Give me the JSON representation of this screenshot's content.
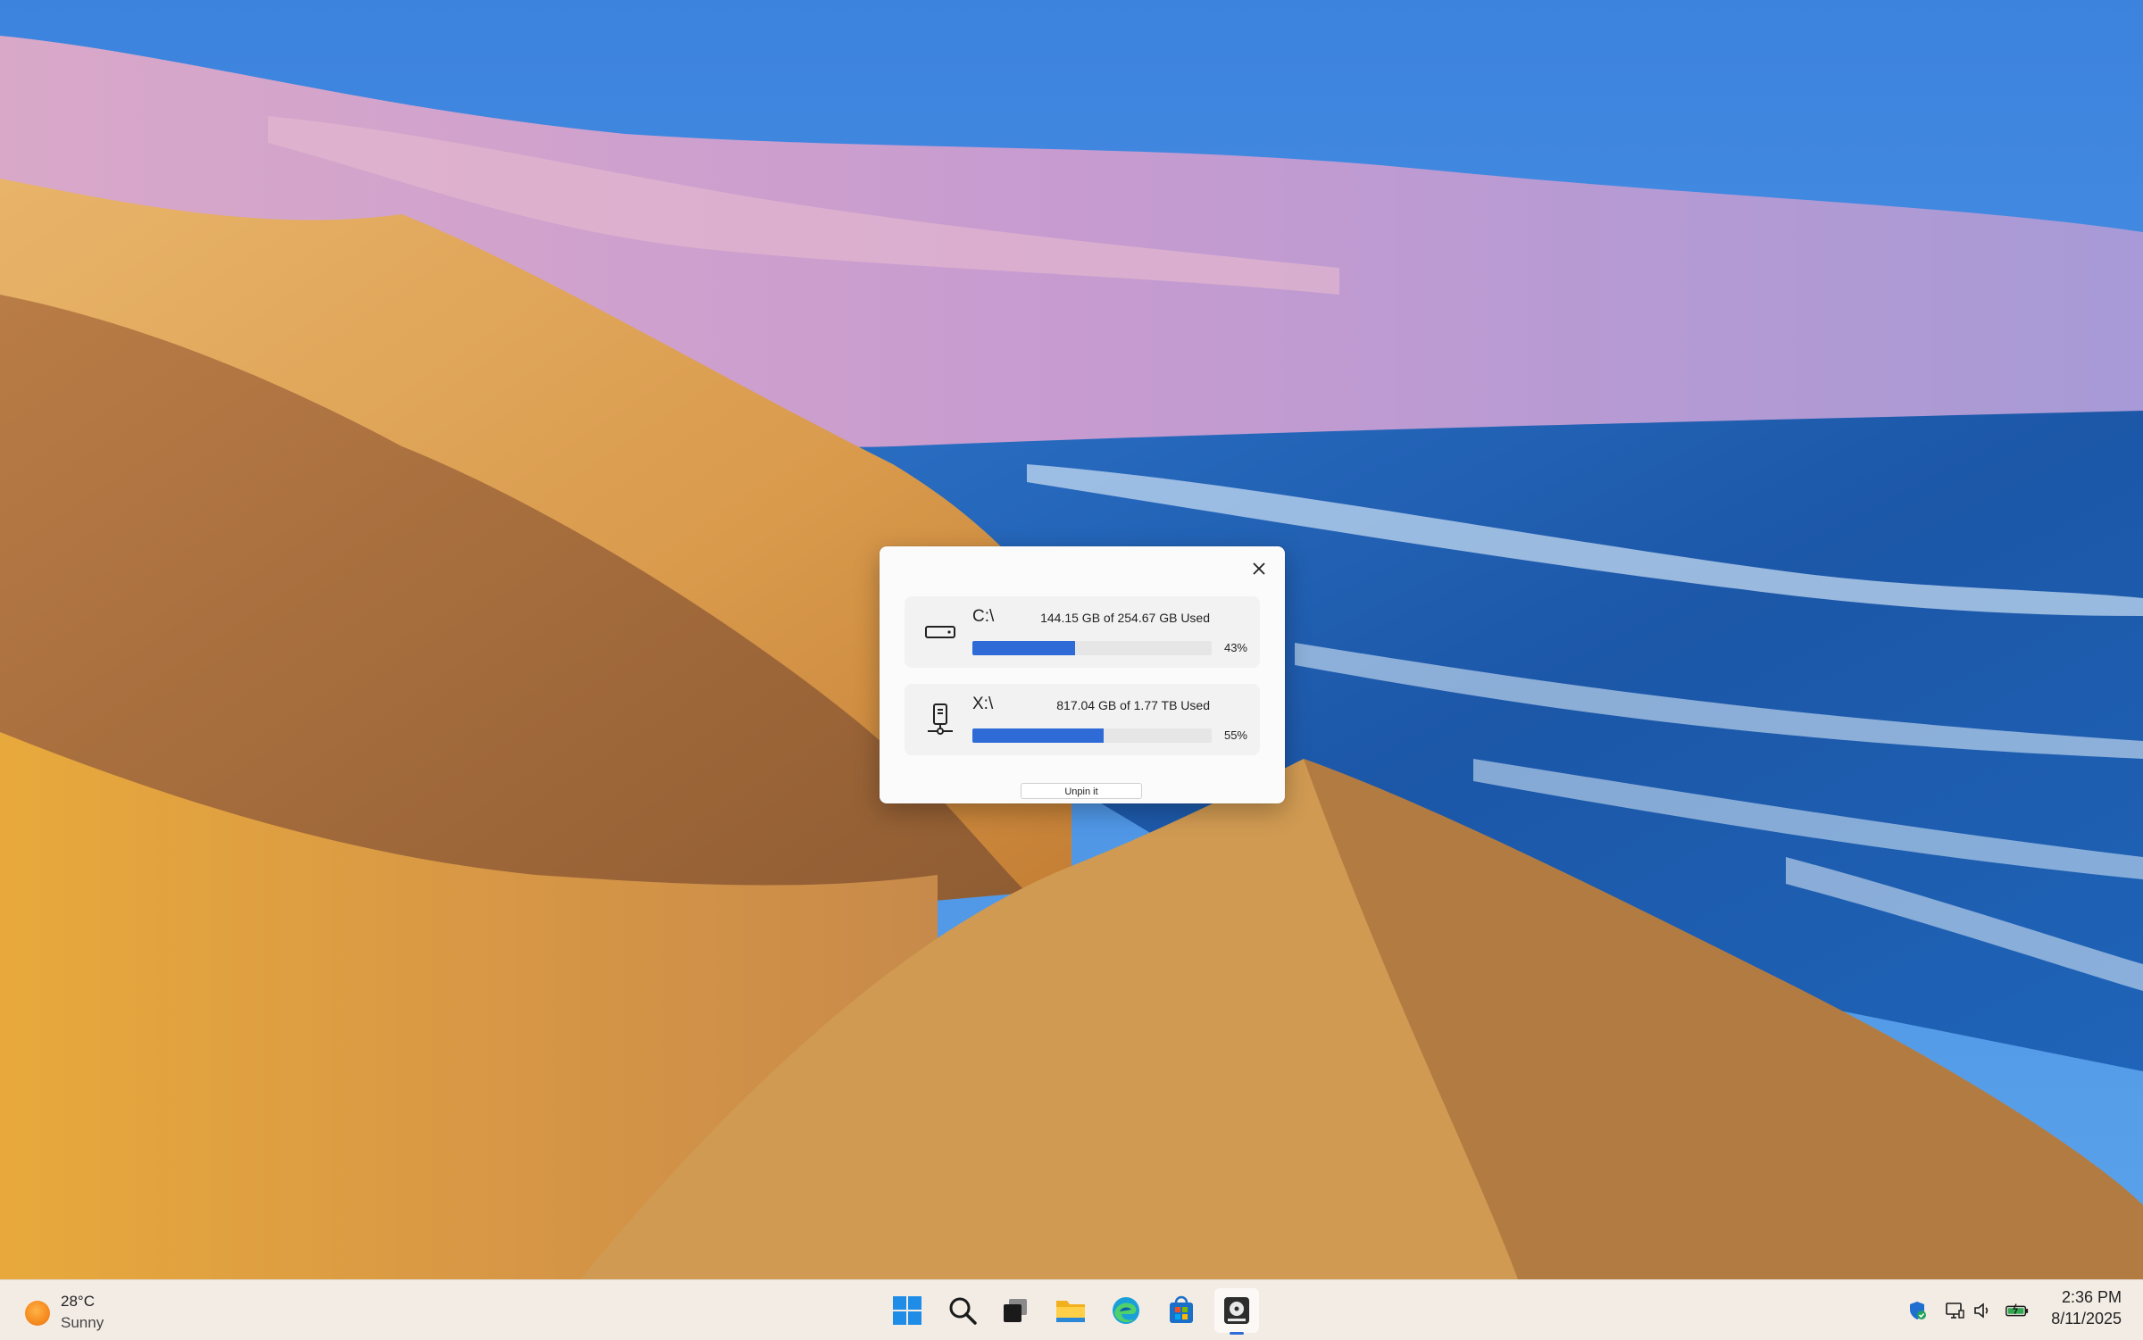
{
  "widget": {
    "close_icon": "close-icon",
    "drives": [
      {
        "letter": "C:\\",
        "usage": "144.15 GB of 254.67 GB Used",
        "percent_label": "43%",
        "percent": 43,
        "icon": "hard-drive-icon"
      },
      {
        "letter": "X:\\",
        "usage": "817.04 GB of 1.77 TB Used",
        "percent_label": "55%",
        "percent": 55,
        "icon": "network-drive-icon"
      }
    ],
    "unpin_label": "Unpin it"
  },
  "taskbar": {
    "weather": {
      "temp": "28°C",
      "condition": "Sunny",
      "icon": "sun-icon"
    },
    "apps": [
      "start-icon",
      "search-icon",
      "task-view-icon",
      "file-explorer-icon",
      "edge-icon",
      "store-icon",
      "drive-widget-app-icon"
    ],
    "tray": [
      "defender-icon",
      "network-icon",
      "volume-icon",
      "battery-icon"
    ],
    "time": "2:36 PM",
    "date": "8/11/2025"
  },
  "colors": {
    "accent": "#2f6bd6",
    "taskbar": "#f3ece5"
  }
}
